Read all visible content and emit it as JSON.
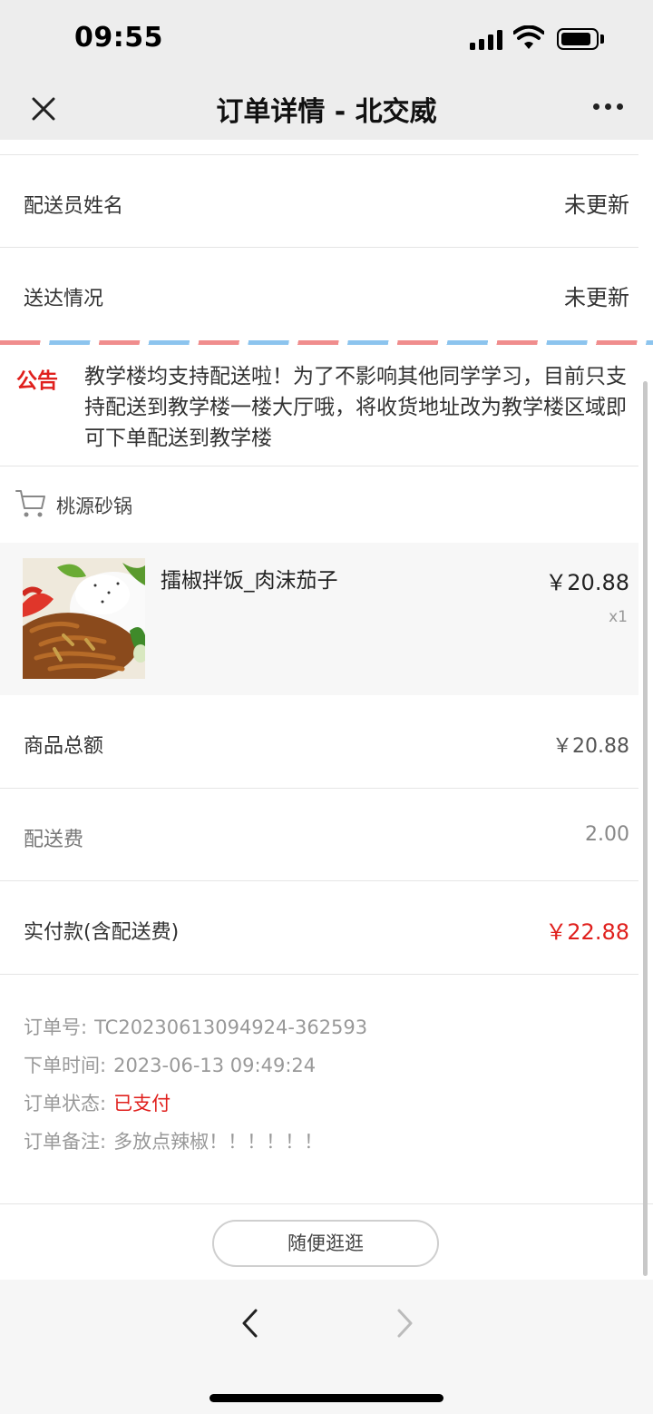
{
  "status_bar": {
    "time": "09:55"
  },
  "nav": {
    "title": "订单详情 - 北交威"
  },
  "delivery": {
    "courier_label": "配送员姓名",
    "courier_value": "未更新",
    "status_label": "送达情况",
    "status_value": "未更新"
  },
  "notice": {
    "tag": "公告",
    "text": "教学楼均支持配送啦！为了不影响其他同学学习，目前只支持配送到教学楼一楼大厅哦，将收货地址改为教学楼区域即可下单配送到教学楼"
  },
  "shop": {
    "name": "桃源砂锅",
    "icon": "cart-icon"
  },
  "item": {
    "name": "擂椒拌饭_肉沫茄子",
    "price": "￥20.88",
    "quantity": "x1"
  },
  "summary": {
    "goods_total_label": "商品总额",
    "goods_total_value": "￥20.88",
    "delivery_fee_label": "配送费",
    "delivery_fee_value": "2.00",
    "paid_label": "实付款(含配送费)",
    "paid_value": "￥22.88"
  },
  "order_info": {
    "number_label": "订单号:",
    "number_value": "TC20230613094924-362593",
    "time_label": "下单时间:",
    "time_value": "2023-06-13 09:49:24",
    "status_label": "订单状态:",
    "status_value": "已支付",
    "note_label": "订单备注:",
    "note_value": "多放点辣椒！！！！！！"
  },
  "footer": {
    "browse_button": "随便逛逛"
  },
  "colors": {
    "accent_red": "#e0201d",
    "bar_bg": "#ededed"
  }
}
